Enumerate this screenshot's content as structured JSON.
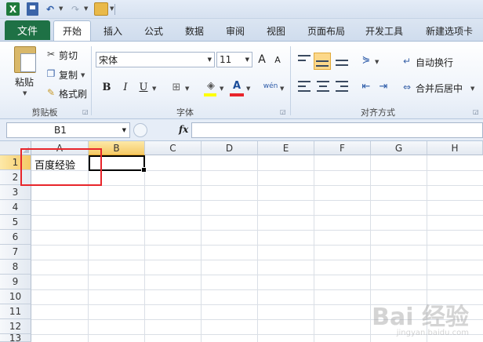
{
  "qat": {
    "logo_letter": "X",
    "undo": "↶",
    "redo": "↷"
  },
  "tabs": {
    "file": "文件",
    "items": [
      "开始",
      "插入",
      "公式",
      "数据",
      "审阅",
      "视图",
      "页面布局",
      "开发工具",
      "新建选项卡"
    ]
  },
  "ribbon": {
    "clipboard": {
      "paste": "粘贴",
      "cut": "剪切",
      "copy": "复制",
      "format_painter": "格式刷",
      "label": "剪贴板"
    },
    "font": {
      "font_name": "宋体",
      "font_size": "11",
      "bold": "B",
      "italic": "I",
      "underline": "U",
      "label": "字体",
      "grow": "A",
      "shrink": "A",
      "phonetic": "wén"
    },
    "alignment": {
      "wrap": "自动换行",
      "merge": "合并后居中",
      "label": "对齐方式"
    }
  },
  "formula_bar": {
    "name_box": "B1",
    "fx": "fx",
    "content": ""
  },
  "grid": {
    "columns": [
      "A",
      "B",
      "C",
      "D",
      "E",
      "F",
      "G",
      "H"
    ],
    "rows": [
      "1",
      "2",
      "3",
      "4",
      "5",
      "6",
      "7",
      "8",
      "9",
      "10",
      "11",
      "12",
      "13"
    ],
    "cells": {
      "A1": "百度经验"
    },
    "selected_cell": "B1"
  },
  "watermark": {
    "brand": "Bai 经验",
    "url": "jingyan.baidu.com"
  },
  "colors": {
    "file_tab": "#1e7145",
    "highlight": "#e8252b",
    "selection_header": "#f5c965"
  }
}
